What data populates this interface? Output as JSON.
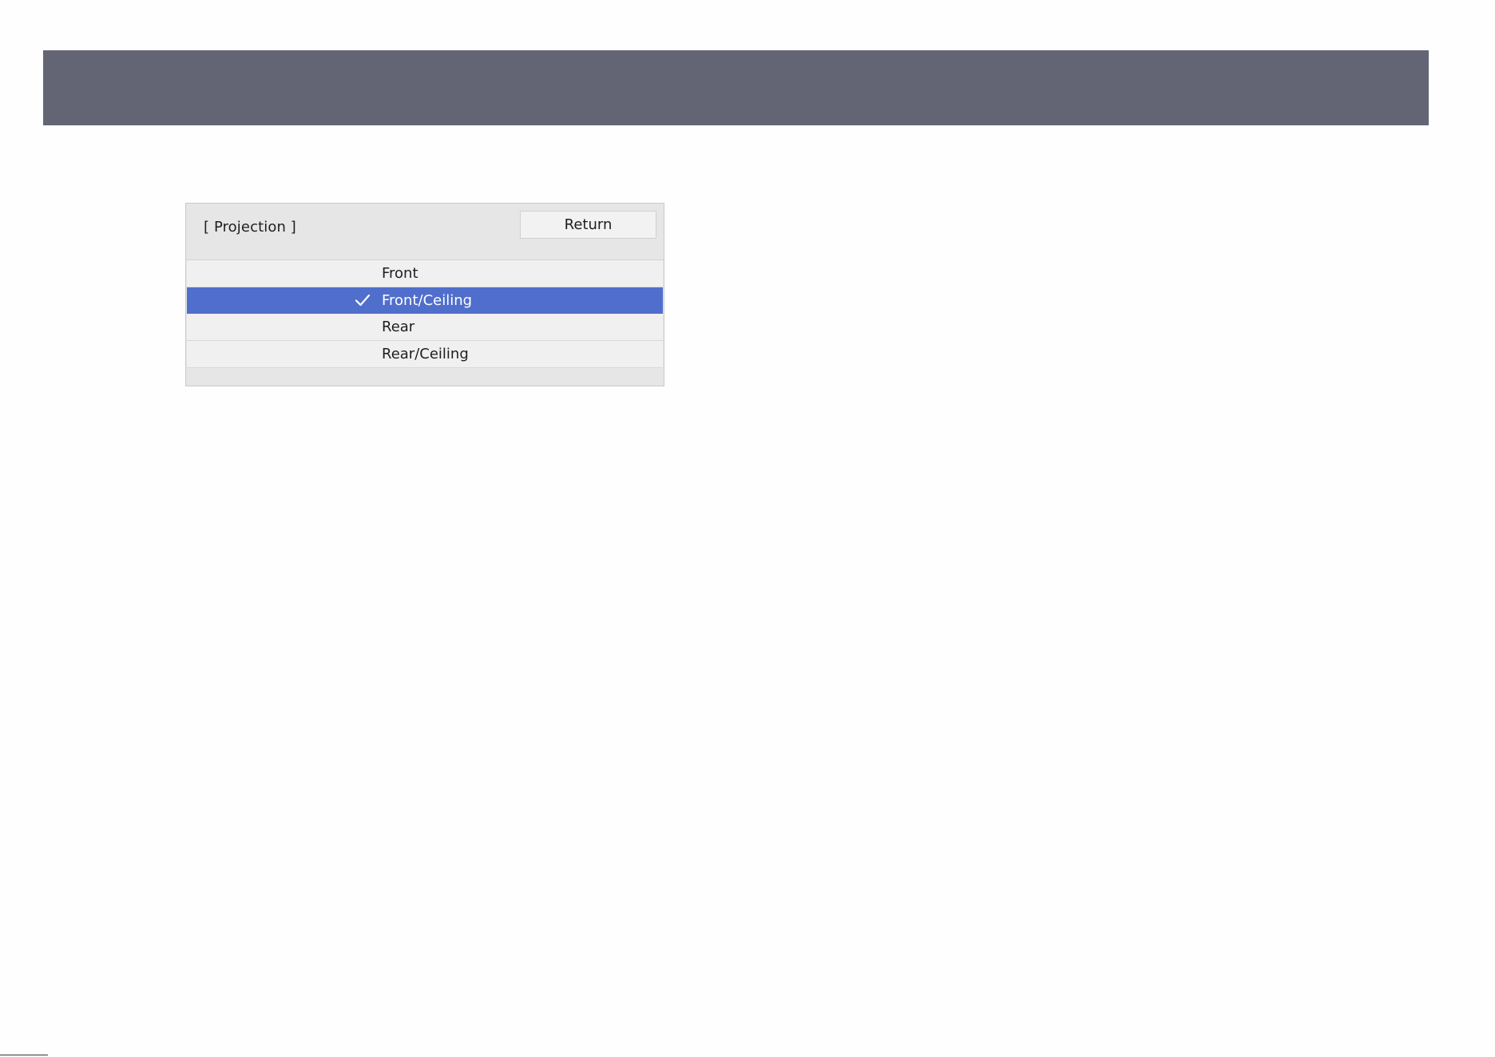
{
  "menu": {
    "title": "[ Projection ]",
    "return_label": "Return",
    "options": [
      {
        "label": "Front",
        "selected": false
      },
      {
        "label": "Front/Ceiling",
        "selected": true
      },
      {
        "label": "Rear",
        "selected": false
      },
      {
        "label": "Rear/Ceiling",
        "selected": false
      }
    ],
    "selected_option": "Front/Ceiling",
    "selection_indicator_icon": "checkmark-icon"
  },
  "colors": {
    "header_bar": "#636574",
    "selection_highlight": "#506ecc",
    "panel_background": "#e6e6e6",
    "row_background": "#f0f0f0"
  }
}
